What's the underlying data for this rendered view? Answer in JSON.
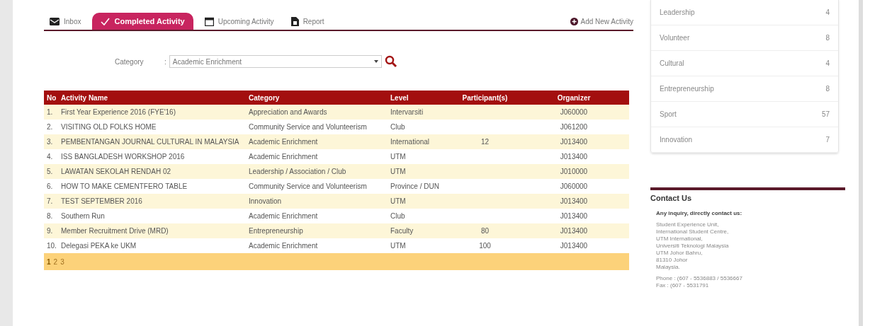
{
  "tabs": [
    {
      "label": "Inbox",
      "kind": "inbox",
      "selected": false
    },
    {
      "label": "Completed Activity",
      "kind": "check",
      "selected": true
    },
    {
      "label": "Upcoming Activity",
      "kind": "calendar",
      "selected": false
    },
    {
      "label": "Report",
      "kind": "report",
      "selected": false
    }
  ],
  "add_button": "Add New Activity",
  "filter": {
    "label": "Category",
    "separator": ":",
    "value": "Academic Enrichment"
  },
  "table": {
    "columns": [
      "No",
      "Activity Name",
      "Category",
      "Level",
      "Participant(s)",
      "Organizer"
    ],
    "rows": [
      [
        "1.",
        "First Year Experience 2016 (FYE'16)",
        "Appreciation and Awards",
        "Intervarsiti",
        "",
        "J060000"
      ],
      [
        "2.",
        "VISITING OLD FOLKS HOME",
        "Community Service and Volunteerism",
        "Club",
        "",
        "J061200"
      ],
      [
        "3.",
        "PEMBENTANGAN JOURNAL CULTURAL IN MALAYSIA",
        "Academic Enrichment",
        "International",
        "12",
        "J013400"
      ],
      [
        "4.",
        "ISS BANGLADESH WORKSHOP 2016",
        "Academic Enrichment",
        "UTM",
        "",
        "J013400"
      ],
      [
        "5.",
        "LAWATAN SEKOLAH RENDAH 02",
        "Leadership / Association / Club",
        "UTM",
        "",
        "J010000"
      ],
      [
        "6.",
        "HOW TO MAKE CEMENTFERO TABLE",
        "Community Service and Volunteerism",
        "Province / DUN",
        "",
        "J060000"
      ],
      [
        "7.",
        "TEST SEPTEMBER 2016",
        "Innovation",
        "UTM",
        "",
        "J013400"
      ],
      [
        "8.",
        "Southern Run",
        "Academic Enrichment",
        "Club",
        "",
        "J013400"
      ],
      [
        "9.",
        "Member Recruitment Drive (MRD)",
        "Entrepreneurship",
        "Faculty",
        "80",
        "J013400"
      ],
      [
        "10.",
        "Delegasi PEKA ke UKM",
        "Academic Enrichment",
        "UTM",
        "100",
        "J013400"
      ]
    ],
    "pages": [
      {
        "label": "1",
        "selected": true
      },
      {
        "label": "2",
        "selected": false
      },
      {
        "label": "3",
        "selected": false
      }
    ]
  },
  "sidebar": {
    "items": [
      {
        "label": "Leadership",
        "count": "4"
      },
      {
        "label": "Volunteer",
        "count": "8"
      },
      {
        "label": "Cultural",
        "count": "4"
      },
      {
        "label": "Entrepreneurship",
        "count": "8"
      },
      {
        "label": "Sport",
        "count": "57"
      },
      {
        "label": "Innovation",
        "count": "7"
      }
    ]
  },
  "contact": {
    "title": "Contact Us",
    "intro": "Any inquiry, directly contact us:",
    "address": [
      "Student Experience Unit,",
      "International Student Centre,",
      "UTM International,",
      "Universiti Teknologi Malaysia",
      "UTM Johor Bahru,",
      "81310 Johor",
      "Malaysia."
    ],
    "phone": [
      "Phone : (607 - 5536883 / 5536667",
      "Fax : (607 - 5531791"
    ]
  }
}
